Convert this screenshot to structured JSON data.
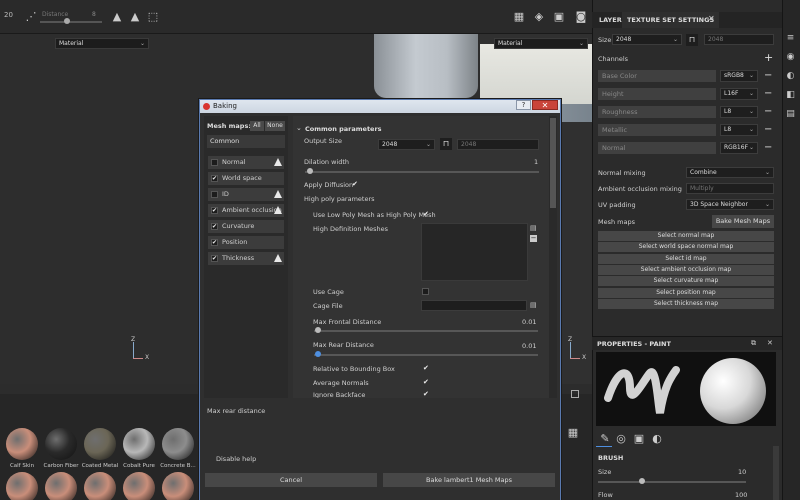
{
  "toolbar": {
    "size_value": "20",
    "distance_label": "Distance",
    "distance_value": "8"
  },
  "viewport": {
    "left_material": "Material",
    "right_material": "Material",
    "axis_x": "X",
    "axis_z": "Z"
  },
  "materials": [
    {
      "label": "Calf Skin",
      "color": "#c98e7a"
    },
    {
      "label": "Carbon Fiber",
      "color": "#2a2a2a"
    },
    {
      "label": "Coated Metal",
      "color": "#6b6656"
    },
    {
      "label": "Cobalt Pure",
      "color": "#b8b8b8"
    },
    {
      "label": "Concrete B...",
      "color": "#8d8d8d"
    }
  ],
  "layers_panel": {
    "tab_layers": "LAYERS",
    "tab_texture_set": "TEXTURE SET SETTINGS",
    "size_label": "Size",
    "size_value": "2048",
    "size_locked_value": "2048",
    "channels_label": "Channels",
    "channels": [
      {
        "name": "Base Color",
        "format": "sRGB8"
      },
      {
        "name": "Height",
        "format": "L16F"
      },
      {
        "name": "Roughness",
        "format": "L8"
      },
      {
        "name": "Metallic",
        "format": "L8"
      },
      {
        "name": "Normal",
        "format": "RGB16F"
      }
    ],
    "normal_mixing_label": "Normal mixing",
    "normal_mixing_value": "Combine",
    "ao_mixing_label": "Ambient occlusion mixing",
    "ao_mixing_value": "Multiply",
    "uv_padding_label": "UV padding",
    "uv_padding_value": "3D Space Neighbor",
    "mesh_maps_label": "Mesh maps",
    "bake_button": "Bake Mesh Maps",
    "select_buttons": [
      "Select normal map",
      "Select world space normal map",
      "Select id map",
      "Select ambient occlusion map",
      "Select curvature map",
      "Select position map",
      "Select thickness map"
    ]
  },
  "properties": {
    "title": "PROPERTIES - PAINT",
    "brush_label": "BRUSH",
    "size_label": "Size",
    "size_value": "10",
    "flow_label": "Flow",
    "flow_value": "100"
  },
  "dialog": {
    "title": "Baking",
    "help_label": "?",
    "close_label": "✕",
    "mesh_maps_label": "Mesh maps:",
    "all_label": "All",
    "none_label": "None",
    "common_label": "Common",
    "maps": [
      {
        "label": "Normal",
        "checked": false,
        "warn": true
      },
      {
        "label": "World space normal",
        "checked": true,
        "warn": false
      },
      {
        "label": "ID",
        "checked": false,
        "warn": true
      },
      {
        "label": "Ambient occlusion",
        "checked": true,
        "warn": true
      },
      {
        "label": "Curvature",
        "checked": true,
        "warn": false
      },
      {
        "label": "Position",
        "checked": true,
        "warn": false
      },
      {
        "label": "Thickness",
        "checked": true,
        "warn": true
      }
    ],
    "section_title": "Common parameters",
    "output_size_label": "Output Size",
    "output_size_value": "2048",
    "output_size_locked": "2048",
    "dilation_label": "Dilation width",
    "dilation_value": "1",
    "apply_diffusion_label": "Apply Diffusion",
    "high_poly_label": "High poly parameters",
    "use_low_poly_label": "Use Low Poly Mesh as High Poly Mesh",
    "hd_meshes_label": "High Definition Meshes",
    "use_cage_label": "Use Cage",
    "cage_file_label": "Cage File",
    "max_frontal_label": "Max Frontal Distance",
    "max_frontal_value": "0.01",
    "max_rear_label": "Max Rear Distance",
    "max_rear_value": "0.01",
    "relative_bbox_label": "Relative to Bounding Box",
    "average_normals_label": "Average Normals",
    "ignore_backface_label": "Ignore Backface",
    "hint_text": "Max rear distance",
    "disable_help_label": "Disable help",
    "cancel_label": "Cancel",
    "bake_label": "Bake lambert1 Mesh Maps"
  },
  "icons": {
    "check": "✔",
    "chevron": "⌄",
    "lock": "🔒",
    "plus": "+",
    "minus": "−"
  }
}
